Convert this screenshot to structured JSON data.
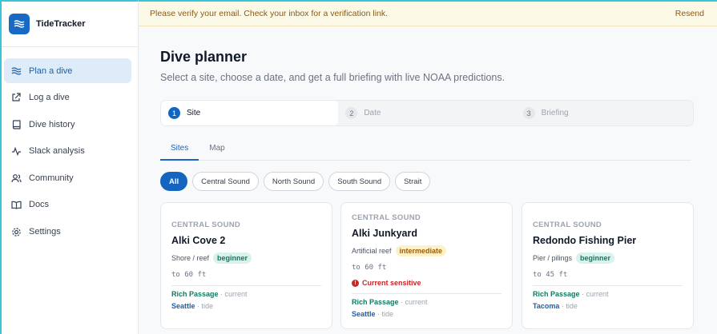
{
  "app": {
    "name": "TideTracker"
  },
  "sidebar": {
    "items": [
      {
        "label": "Plan a dive",
        "icon": "waves-icon",
        "active": true
      },
      {
        "label": "Log a dive",
        "icon": "external-link-icon"
      },
      {
        "label": "Dive history",
        "icon": "book-icon"
      },
      {
        "label": "Slack analysis",
        "icon": "activity-icon"
      },
      {
        "label": "Community",
        "icon": "users-icon"
      },
      {
        "label": "Docs",
        "icon": "open-book-icon"
      },
      {
        "label": "Settings",
        "icon": "gear-icon"
      }
    ]
  },
  "banner": {
    "message": "Please verify your email. Check your inbox for a verification link.",
    "action": "Resend"
  },
  "page": {
    "title": "Dive planner",
    "subtitle": "Select a site, choose a date, and get a full briefing with live NOAA predictions."
  },
  "stepper": [
    {
      "num": "1",
      "label": "Site"
    },
    {
      "num": "2",
      "label": "Date"
    },
    {
      "num": "3",
      "label": "Briefing"
    }
  ],
  "tabs": [
    "Sites",
    "Map"
  ],
  "filters": [
    "All",
    "Central Sound",
    "North Sound",
    "South Sound",
    "Strait"
  ],
  "cards": [
    {
      "region": "CENTRAL SOUND",
      "name": "Alki Cove 2",
      "type": "Shore / reef",
      "level": "beginner",
      "depth": "to 60 ft",
      "alert": "",
      "current_station": "Rich Passage",
      "current_label": " · current",
      "tide_station": "Seattle",
      "tide_label": " · tide"
    },
    {
      "region": "CENTRAL SOUND",
      "name": "Alki Junkyard",
      "type": "Artificial reef",
      "level": "intermediate",
      "depth": "to 60 ft",
      "alert": "Current sensitive",
      "current_station": "Rich Passage",
      "current_label": " · current",
      "tide_station": "Seattle",
      "tide_label": " · tide"
    },
    {
      "region": "CENTRAL SOUND",
      "name": "Redondo Fishing Pier",
      "type": "Pier / pilings",
      "level": "beginner",
      "depth": "to 45 ft",
      "alert": "",
      "current_station": "Rich Passage",
      "current_label": " · current",
      "tide_station": "Tacoma",
      "tide_label": " · tide"
    }
  ],
  "colors": {
    "accent": "#1565c0",
    "brand": "#1769c4",
    "banner_bg": "#fdf9e7",
    "beginner": "#0f7a60",
    "intermediate": "#a15c07",
    "alert": "#c62828"
  }
}
